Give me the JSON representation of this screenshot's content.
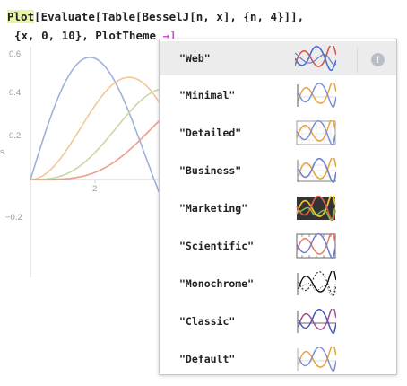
{
  "code": {
    "plot_kw": "Plot",
    "line1_rest": "[Evaluate[Table[BesselJ[n, x], {n, 4}]],",
    "line2_text": "{x, 0, 10}, PlotTheme ",
    "arrow": "→]"
  },
  "plot": {
    "ticks_y": [
      "0.6",
      "0.4",
      "0.2",
      "−0.2"
    ],
    "tick_x": "2",
    "side_mark": "s",
    "colors": [
      "#9fb1db",
      "#f4c79a",
      "#c8d8a4",
      "#ef9d8a"
    ]
  },
  "themes": [
    {
      "label": "\"Web\"",
      "selected": true
    },
    {
      "label": "\"Minimal\""
    },
    {
      "label": "\"Detailed\""
    },
    {
      "label": "\"Business\""
    },
    {
      "label": "\"Marketing\""
    },
    {
      "label": "\"Scientific\""
    },
    {
      "label": "\"Monochrome\""
    },
    {
      "label": "\"Classic\""
    },
    {
      "label": "\"Default\""
    }
  ],
  "icons": {
    "info": "i"
  }
}
